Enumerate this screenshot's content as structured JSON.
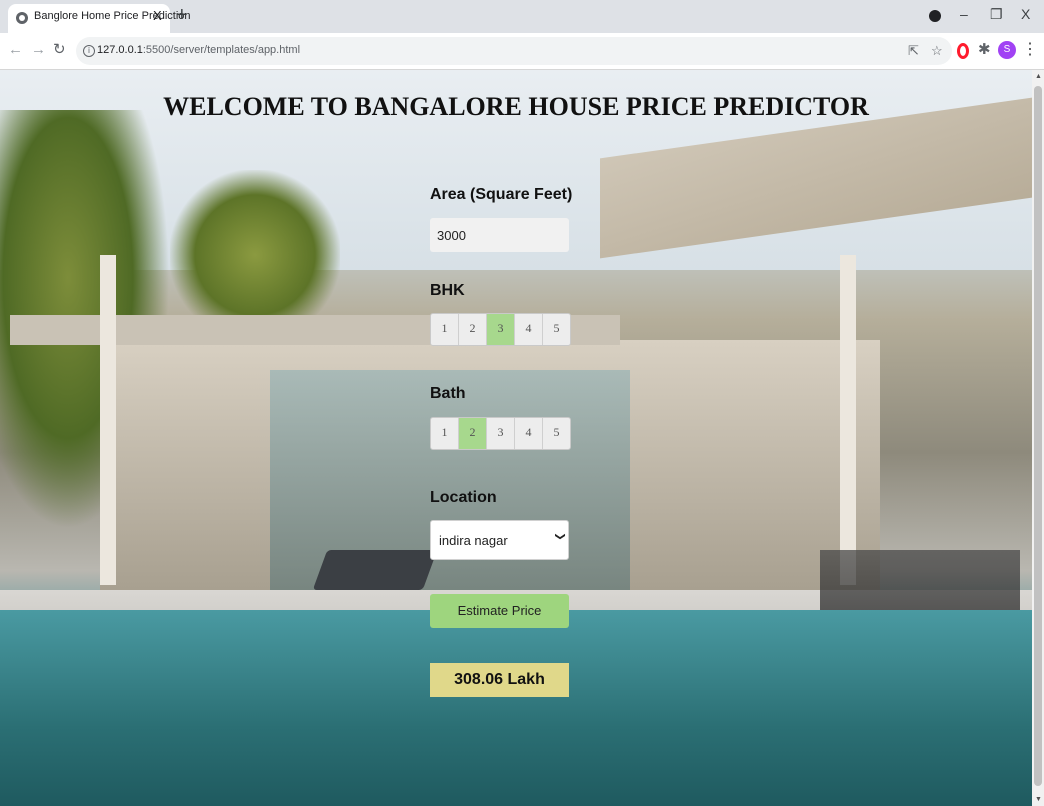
{
  "browser": {
    "tab_title": "Banglore Home Price Prediction",
    "tab_close": "X",
    "new_tab": "+",
    "url_host": "127.0.0.1",
    "url_path": ":5500/server/templates/app.html",
    "avatar_initial": "S",
    "window_controls": {
      "minimize": "–",
      "restore": "❐",
      "close": "X"
    }
  },
  "app": {
    "title": "WELCOME TO BANGALORE HOUSE PRICE PREDICTOR",
    "area": {
      "label": "Area (Square Feet)",
      "value": "3000"
    },
    "bhk": {
      "label": "BHK",
      "options": [
        "1",
        "2",
        "3",
        "4",
        "5"
      ],
      "selected": "3"
    },
    "bath": {
      "label": "Bath",
      "options": [
        "1",
        "2",
        "3",
        "4",
        "5"
      ],
      "selected": "2"
    },
    "location": {
      "label": "Location",
      "selected": "indira nagar"
    },
    "estimate_button": "Estimate Price",
    "result": "308.06 Lakh"
  },
  "colors": {
    "selected_option": "#a7d88d",
    "estimate_button": "#9ed57e",
    "result_bg": "#e0d88a"
  }
}
